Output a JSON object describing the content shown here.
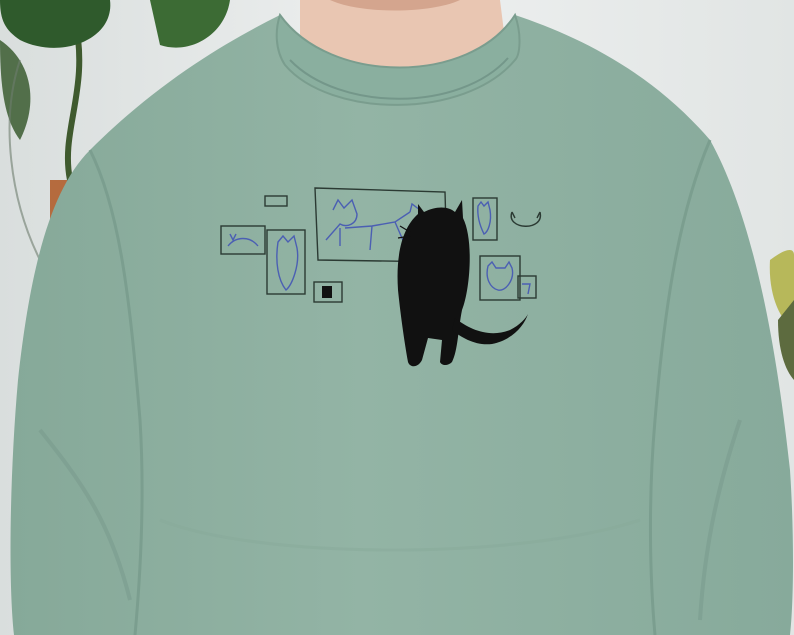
{
  "photo": {
    "subject": "sage-green-crewneck-sweatshirt",
    "print": "black-cat-looking-at-wall-of-cat-drawings",
    "colors": {
      "wall": "#e9ecec",
      "sweatshirt": "#8fb1a2",
      "sweatshirt_shadow": "#7e9f91",
      "skin": "#e9c6b2",
      "ink_black": "#111111",
      "ink_blue": "#4b5fb3",
      "ink_line": "#2b3a33",
      "plant_green": "#2f5a2c",
      "pot": "#b56b3e"
    }
  }
}
